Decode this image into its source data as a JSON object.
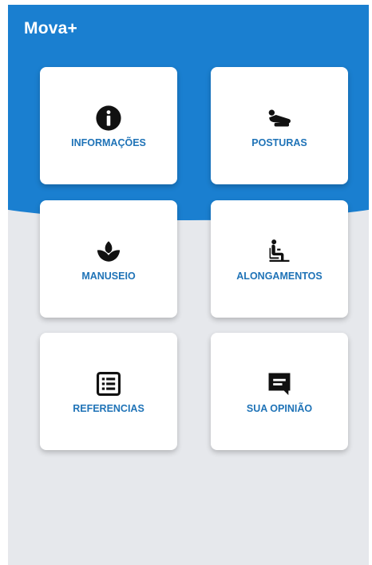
{
  "app": {
    "title": "Mova+",
    "colors": {
      "primary": "#1a7fd0",
      "label": "#1f73b7",
      "background": "#e6e8ec",
      "card": "#ffffff"
    }
  },
  "menu": {
    "tiles": [
      {
        "label": "INFORMAÇÕES",
        "icon": "info-icon"
      },
      {
        "label": "POSTURAS",
        "icon": "posture-icon"
      },
      {
        "label": "MANUSEIO",
        "icon": "spa-icon"
      },
      {
        "label": "ALONGAMENTOS",
        "icon": "seated-person-icon"
      },
      {
        "label": "REFERENCIAS",
        "icon": "list-icon"
      },
      {
        "label": "SUA OPINIÃO",
        "icon": "comment-icon"
      }
    ]
  }
}
